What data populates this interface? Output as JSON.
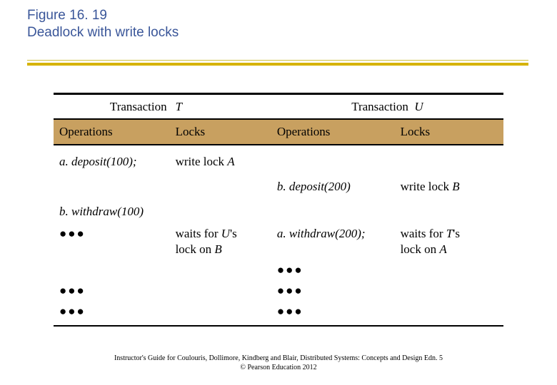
{
  "title": {
    "line1": "Figure 16. 19",
    "line2": "Deadlock with write locks"
  },
  "table": {
    "top": {
      "label": "Transaction",
      "t_name": "T",
      "u_label": "Transaction",
      "u_name": "U"
    },
    "head": {
      "ops_l": "Operations",
      "locks_l": "Locks",
      "ops_r": "Operations",
      "locks_r": "Locks"
    },
    "rows": {
      "r1_op": "a. deposit(100);",
      "r1_lock_pre": "write lock ",
      "r1_lock_obj": "A",
      "r2_op": "b. deposit(200)",
      "r2_lock_pre": "write lock ",
      "r2_lock_obj": "B",
      "r3_op": "b. withdraw(100)",
      "r4_wait_pre": "waits for ",
      "r4_wait_u": "U",
      "r4_wait_mid": "'s",
      "r4_wait_line2a": "lock on ",
      "r4_wait_line2b": "B",
      "r4_op_r": "a. withdraw(200);",
      "r4r_wait_pre": "waits for  ",
      "r4r_wait_t": "T",
      "r4r_wait_mid": "'s",
      "r4r_wait_line2a": "lock on ",
      "r4r_wait_line2b": "A",
      "dots": "●●●"
    }
  },
  "footer": {
    "line1": "Instructor's Guide for  Coulouris, Dollimore, Kindberg and Blair,  Distributed Systems: Concepts and Design   Edn. 5",
    "line2": "©  Pearson Education 2012"
  }
}
